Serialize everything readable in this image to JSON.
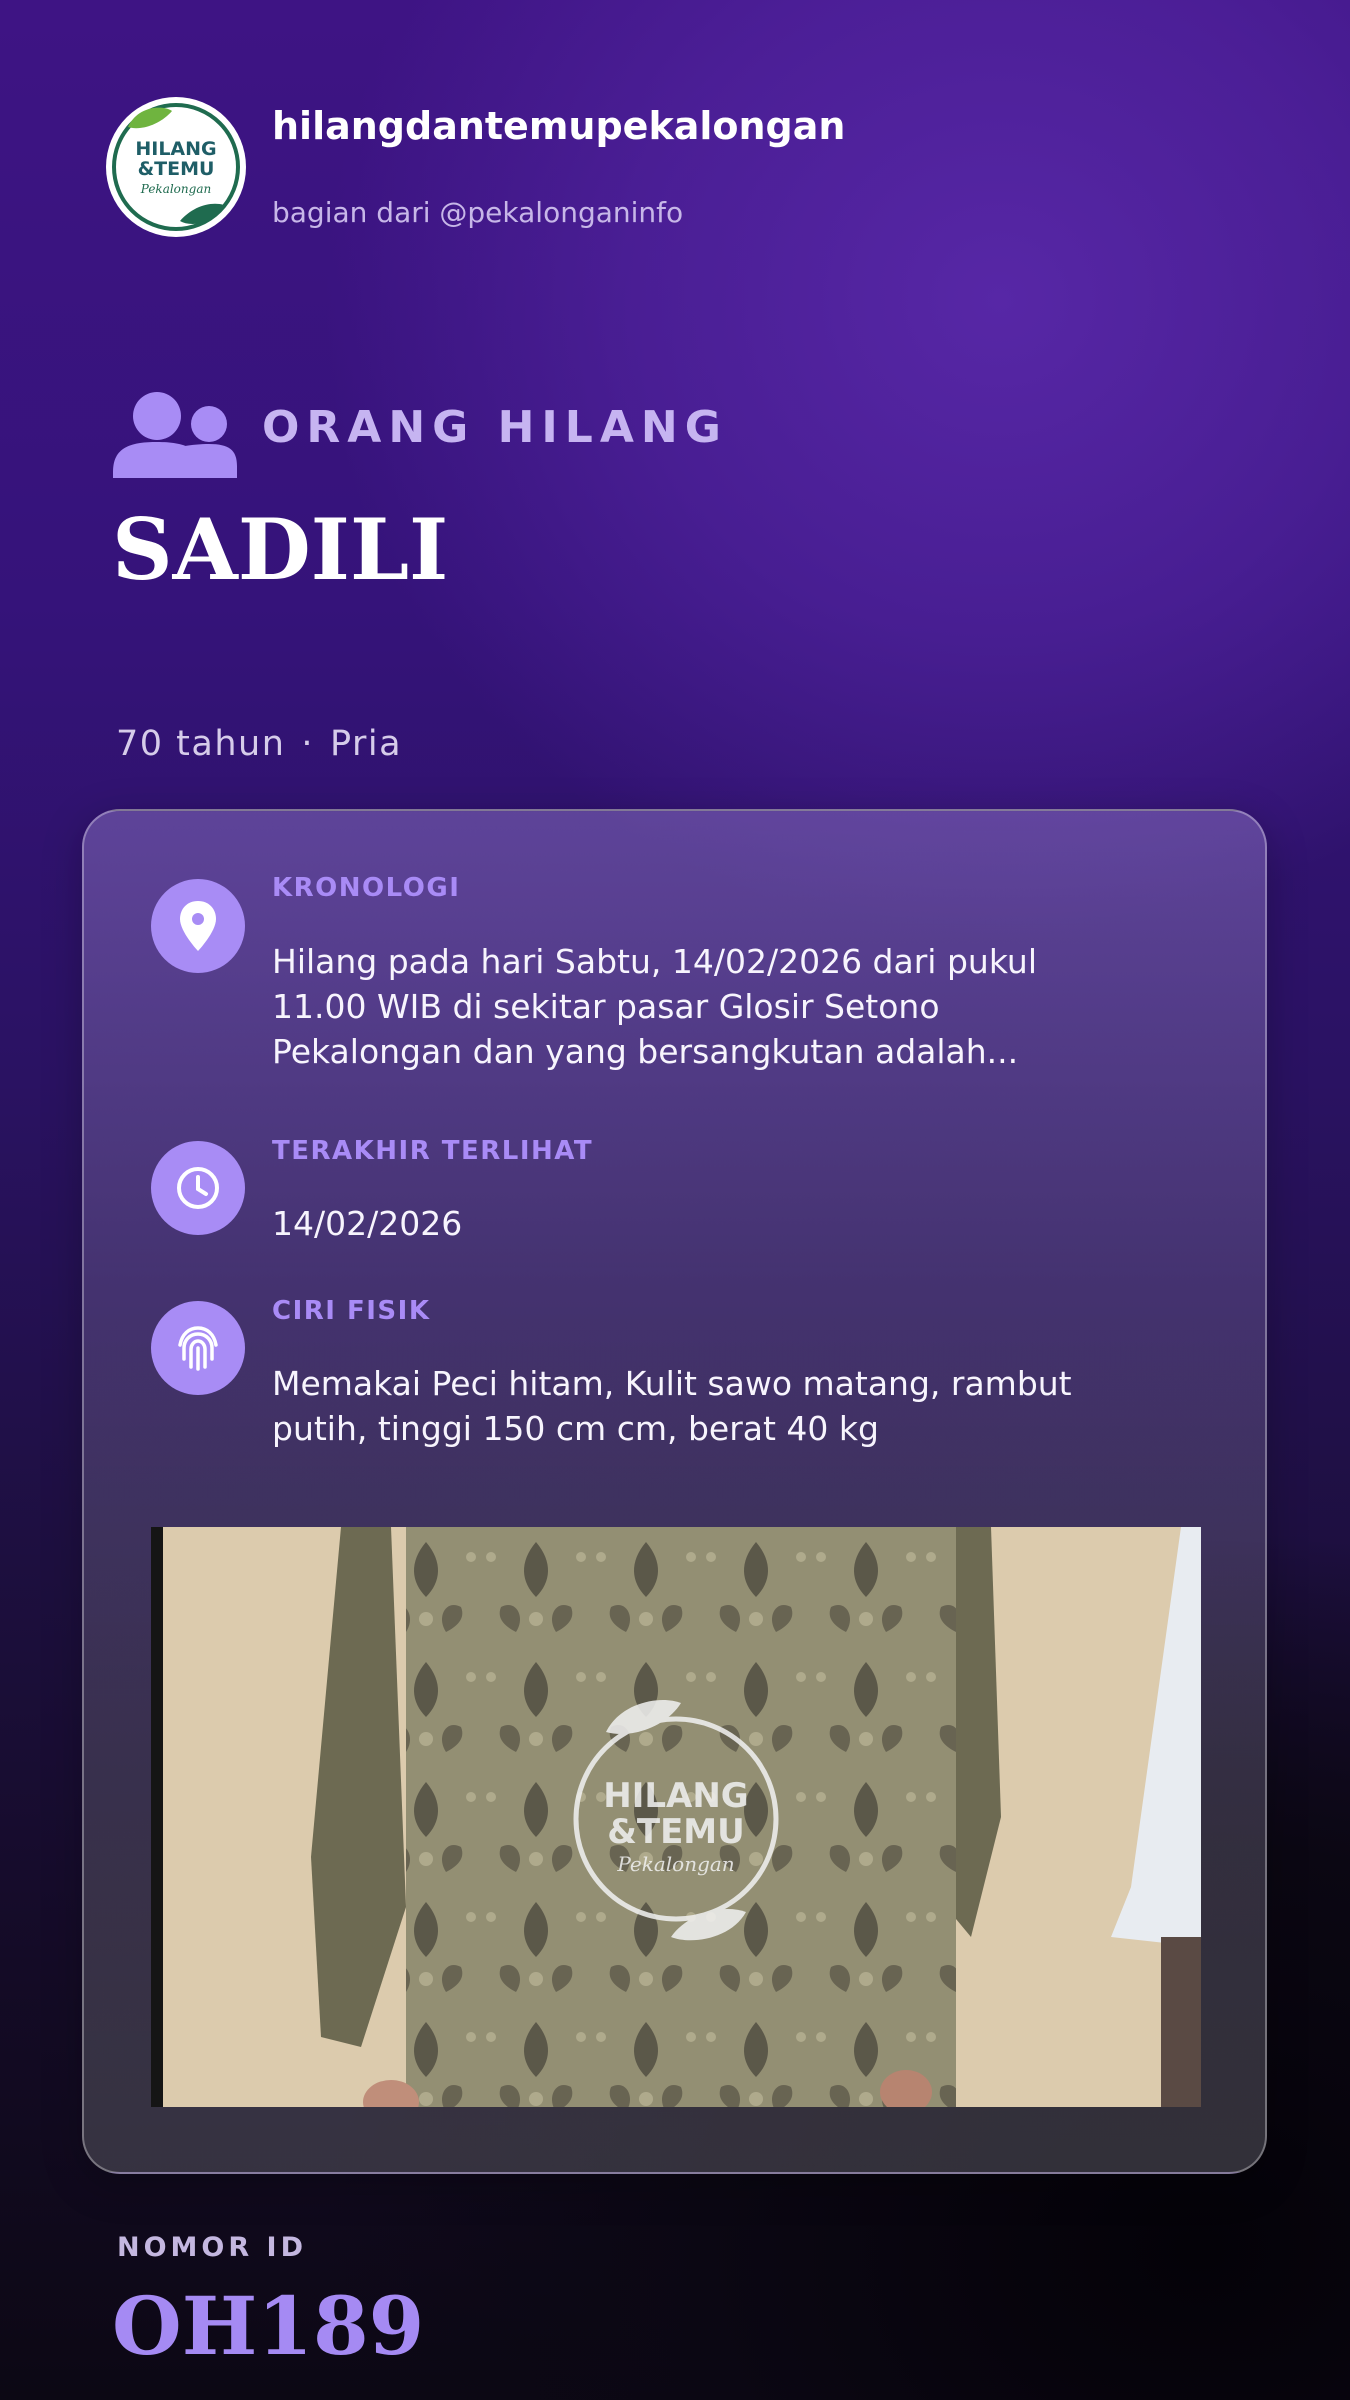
{
  "header": {
    "account_name": "hilangdantemupekalongan",
    "account_sub": "bagian dari @pekalonganinfo",
    "logo_text": [
      "HILANG",
      "&TEMU",
      "Pekalongan"
    ]
  },
  "category": {
    "label": "ORANG HILANG",
    "icon": "users-icon"
  },
  "person": {
    "name": "SADILI",
    "age": "70 tahun",
    "separator": "·",
    "gender": "Pria"
  },
  "details": {
    "chronology": {
      "icon": "map-pin-icon",
      "label": "KRONOLOGI",
      "value": "Hilang pada hari Sabtu, 14/02/2026 dari pukul 11.00 WIB di sekitar pasar Glosir Setono Pekalongan dan yang bersangkutan adalah..."
    },
    "last_seen": {
      "icon": "clock-icon",
      "label": "TERAKHIR TERLIHAT",
      "value": "14/02/2026"
    },
    "physical": {
      "icon": "fingerprint-icon",
      "label": "CIRI FISIK",
      "value": "Memakai Peci hitam, Kulit sawo matang, rambut putih, tinggi 150 cm cm, berat 40 kg"
    }
  },
  "photo": {
    "watermark_text": [
      "HILANG",
      "&TEMU",
      "Pekalongan"
    ]
  },
  "id": {
    "label": "NOMOR ID",
    "value": "OH189"
  },
  "colors": {
    "accent": "#a88cf5",
    "brand_green": "#1f6b4f",
    "background_top": "#3e1484",
    "background_bottom": "#0c0814"
  }
}
